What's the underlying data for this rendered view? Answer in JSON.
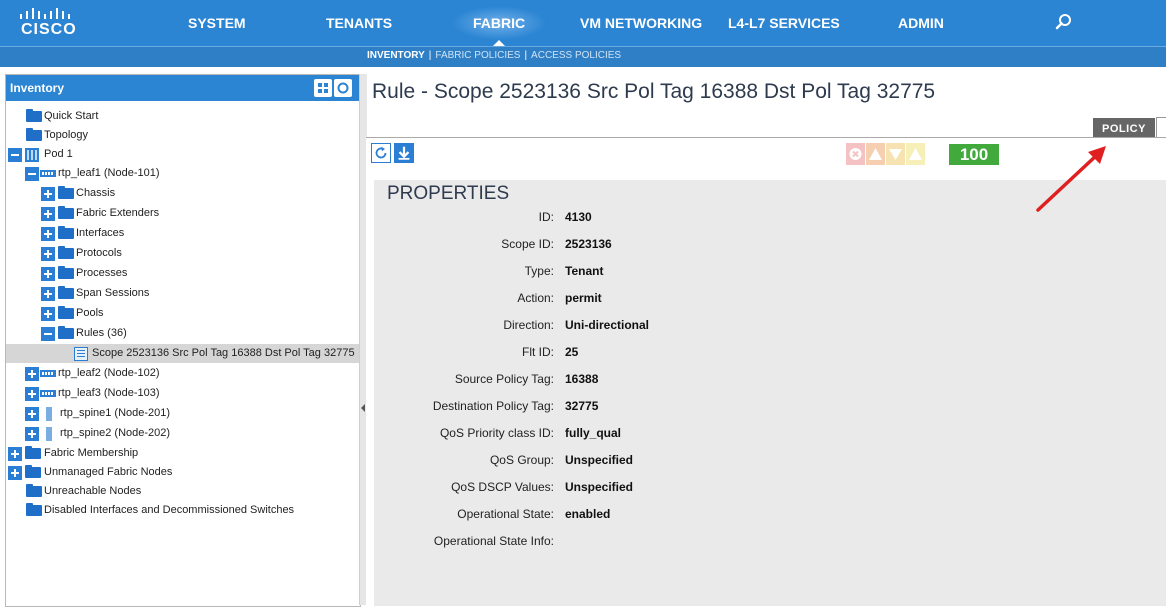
{
  "brand": {
    "logo_text": "CISCO"
  },
  "topnav": {
    "tabs": [
      {
        "label": "SYSTEM"
      },
      {
        "label": "TENANTS"
      },
      {
        "label": "FABRIC"
      },
      {
        "label": "VM NETWORKING"
      },
      {
        "label": "L4-L7 SERVICES"
      },
      {
        "label": "ADMIN"
      }
    ],
    "active": "FABRIC"
  },
  "subnav": {
    "items": [
      {
        "label": "INVENTORY",
        "active": true
      },
      {
        "label": "FABRIC POLICIES"
      },
      {
        "label": "ACCESS POLICIES"
      }
    ],
    "separator": "|"
  },
  "sidebar": {
    "title": "Inventory",
    "items": [
      {
        "label": "Quick Start"
      },
      {
        "label": "Topology"
      },
      {
        "label": "Pod 1"
      },
      {
        "label": "rtp_leaf1 (Node-101)"
      },
      {
        "label": "Chassis"
      },
      {
        "label": "Fabric Extenders"
      },
      {
        "label": "Interfaces"
      },
      {
        "label": "Protocols"
      },
      {
        "label": "Processes"
      },
      {
        "label": "Span Sessions"
      },
      {
        "label": "Pools"
      },
      {
        "label": "Rules (36)"
      },
      {
        "label": "Scope 2523136 Src Pol Tag 16388 Dst Pol Tag 32775"
      },
      {
        "label": "rtp_leaf2 (Node-102)"
      },
      {
        "label": "rtp_leaf3 (Node-103)"
      },
      {
        "label": "rtp_spine1 (Node-201)"
      },
      {
        "label": "rtp_spine2 (Node-202)"
      },
      {
        "label": "Fabric Membership"
      },
      {
        "label": "Unmanaged Fabric Nodes"
      },
      {
        "label": "Unreachable Nodes"
      },
      {
        "label": "Disabled Interfaces and Decommissioned Switches"
      }
    ]
  },
  "main": {
    "title": "Rule - Scope 2523136 Src Pol Tag 16388 Dst Pol Tag 32775",
    "policy_tab": "POLICY",
    "health_score": "100",
    "properties_title": "PROPERTIES",
    "properties": [
      {
        "label": "ID:",
        "value": "4130"
      },
      {
        "label": "Scope ID:",
        "value": "2523136"
      },
      {
        "label": "Type:",
        "value": "Tenant"
      },
      {
        "label": "Action:",
        "value": "permit"
      },
      {
        "label": "Direction:",
        "value": "Uni-directional"
      },
      {
        "label": "Flt ID:",
        "value": "25"
      },
      {
        "label": "Source Policy Tag:",
        "value": "16388"
      },
      {
        "label": "Destination Policy Tag:",
        "value": "32775"
      },
      {
        "label": "QoS Priority class ID:",
        "value": "fully_qual"
      },
      {
        "label": "QoS Group:",
        "value": "Unspecified"
      },
      {
        "label": "QoS DSCP Values:",
        "value": "Unspecified"
      },
      {
        "label": "Operational State:",
        "value": "enabled"
      },
      {
        "label": "Operational State Info:",
        "value": ""
      }
    ]
  },
  "colors": {
    "nav_blue": "#2b85d3",
    "health_green": "#42a93c",
    "annotation_red": "#e02020"
  }
}
